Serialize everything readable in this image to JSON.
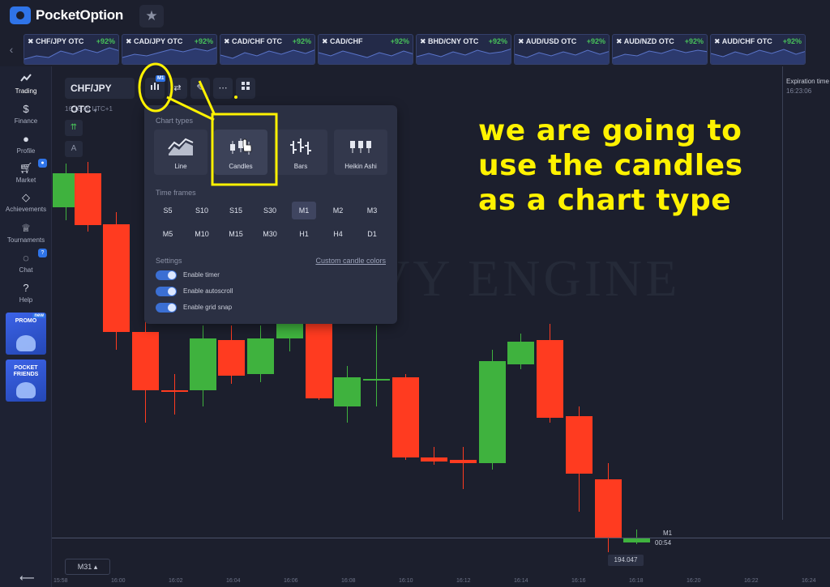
{
  "brand": {
    "name": "PocketOption",
    "accent": "#2f74e8"
  },
  "assets": [
    {
      "name": "CHF/JPY OTC",
      "payout": "+92%"
    },
    {
      "name": "CAD/JPY OTC",
      "payout": "+92%"
    },
    {
      "name": "CAD/CHF OTC",
      "payout": "+92%"
    },
    {
      "name": "CAD/CHF",
      "payout": "+92%"
    },
    {
      "name": "BHD/CNY OTC",
      "payout": "+92%"
    },
    {
      "name": "AUD/USD OTC",
      "payout": "+92%"
    },
    {
      "name": "AUD/NZD OTC",
      "payout": "+92%"
    },
    {
      "name": "AUD/CHF OTC",
      "payout": "+92%"
    }
  ],
  "sidebar": {
    "items": [
      {
        "label": "Trading",
        "icon": "chart-icon"
      },
      {
        "label": "Finance",
        "icon": "dollar-icon"
      },
      {
        "label": "Profile",
        "icon": "user-icon"
      },
      {
        "label": "Market",
        "icon": "cart-icon"
      },
      {
        "label": "Achievements",
        "icon": "diamond-icon"
      },
      {
        "label": "Tournaments",
        "icon": "trophy-icon"
      },
      {
        "label": "Chat",
        "icon": "chat-icon",
        "badge": "?"
      },
      {
        "label": "Help",
        "icon": "help-icon"
      }
    ],
    "promo": {
      "label": "PROMO",
      "badge": "new"
    },
    "friends": {
      "label": "POCKET FRIENDS"
    }
  },
  "toolbar": {
    "pair": "CHF/JPY OTC",
    "timeframe_tag": "M1",
    "server_time": "16:18:45 UTC+1"
  },
  "popup": {
    "chart_types_title": "Chart types",
    "chart_types": [
      {
        "label": "Line",
        "icon": "line-chart-icon",
        "active": false
      },
      {
        "label": "Candles",
        "icon": "candles-icon",
        "active": true
      },
      {
        "label": "Bars",
        "icon": "bars-icon",
        "active": false
      },
      {
        "label": "Heikin Ashi",
        "icon": "heikin-ashi-icon",
        "active": false
      }
    ],
    "time_frames_title": "Time frames",
    "time_frames": [
      "S5",
      "S10",
      "S15",
      "S30",
      "M1",
      "M2",
      "M3",
      "M5",
      "M10",
      "M15",
      "M30",
      "H1",
      "H4",
      "D1"
    ],
    "active_time_frame": "M1",
    "settings_title": "Settings",
    "custom_colors_link": "Custom candle colors",
    "settings": [
      "Enable timer",
      "Enable autoscroll",
      "Enable grid snap"
    ]
  },
  "annotation": {
    "lines": [
      "we are going to",
      "use the candles",
      "as a chart type"
    ],
    "color": "#fff200"
  },
  "chart": {
    "watermark": "HE SAVVY ENGINE",
    "time_ticks": [
      "15:58",
      "16:00",
      "16:02",
      "16:04",
      "16:06",
      "16:08",
      "16:10",
      "16:12",
      "16:14",
      "16:16",
      "16:18",
      "16:20",
      "16:22",
      "16:24"
    ],
    "up_color": "#3fb23e",
    "down_color": "#ff3b20",
    "current_price": "194.047",
    "period_label": "M1",
    "timer": "00:54",
    "zoom_label": "M31"
  },
  "expiration": {
    "label": "Expiration time",
    "time": "16:23:06"
  }
}
